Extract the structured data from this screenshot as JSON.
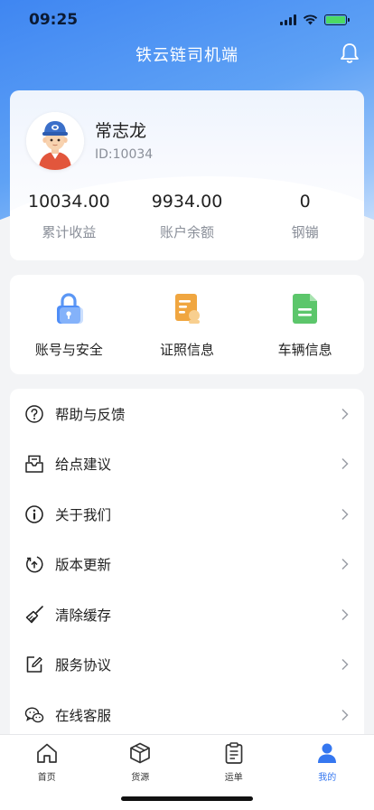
{
  "status_bar": {
    "time": "09:25"
  },
  "header": {
    "title": "铁云链司机端",
    "bell_icon": "bell-icon"
  },
  "profile": {
    "name": "常志龙",
    "id_text": "ID:10034",
    "stats": [
      {
        "value": "10034.00",
        "label": "累计收益"
      },
      {
        "value": "9934.00",
        "label": "账户余额"
      },
      {
        "value": "0",
        "label": "钢镚"
      }
    ]
  },
  "shortcuts": [
    {
      "label": "账号与安全",
      "icon": "lock-icon",
      "color": "#4f8ef7"
    },
    {
      "label": "证照信息",
      "icon": "license-icon",
      "color": "#f0a640"
    },
    {
      "label": "车辆信息",
      "icon": "document-icon",
      "color": "#5cc66b"
    }
  ],
  "menu": [
    {
      "label": "帮助与反馈",
      "icon": "help-icon"
    },
    {
      "label": "给点建议",
      "icon": "suggestion-icon"
    },
    {
      "label": "关于我们",
      "icon": "info-icon"
    },
    {
      "label": "版本更新",
      "icon": "update-icon"
    },
    {
      "label": "清除缓存",
      "icon": "broom-icon"
    },
    {
      "label": "服务协议",
      "icon": "edit-doc-icon"
    },
    {
      "label": "在线客服",
      "icon": "chat-icon"
    }
  ],
  "tabs": [
    {
      "label": "首页",
      "icon": "home-icon",
      "active": false
    },
    {
      "label": "货源",
      "icon": "box-icon",
      "active": false
    },
    {
      "label": "运单",
      "icon": "clipboard-icon",
      "active": false
    },
    {
      "label": "我的",
      "icon": "user-icon",
      "active": true
    }
  ],
  "colors": {
    "accent": "#3577f0",
    "header_gradient_start": "#3f86f2"
  }
}
